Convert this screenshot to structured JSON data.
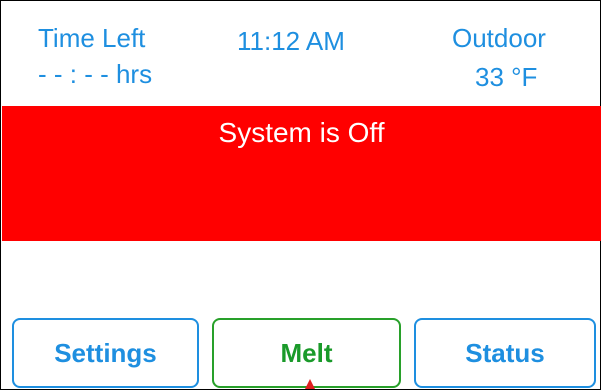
{
  "header": {
    "time_left_label": "Time Left",
    "time_left_value": "- - : - - hrs",
    "clock": "11:12 AM",
    "outdoor_label": "Outdoor",
    "outdoor_value": "33 °F"
  },
  "status": {
    "message": "System is Off",
    "banner_color": "#ff0000"
  },
  "buttons": {
    "settings_label": "Settings",
    "melt_label": "Melt",
    "status_label": "Status"
  },
  "colors": {
    "accent": "#1e8fe0",
    "melt": "#1a9a2a",
    "pointer": "#e02020"
  }
}
